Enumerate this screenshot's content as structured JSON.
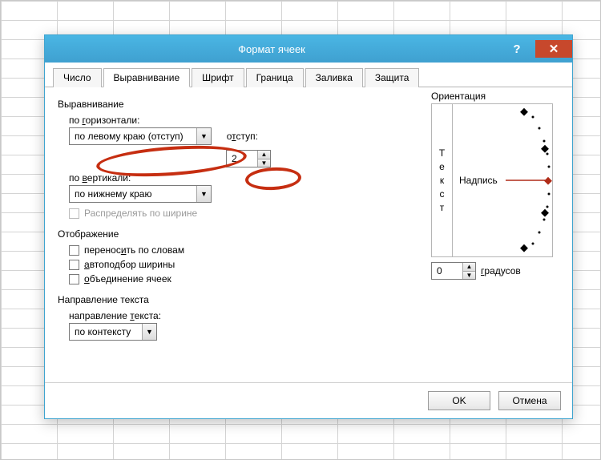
{
  "window": {
    "title": "Формат ячеек"
  },
  "tabs": [
    "Число",
    "Выравнивание",
    "Шрифт",
    "Граница",
    "Заливка",
    "Защита"
  ],
  "active_tab": 1,
  "alignment": {
    "group_title": "Выравнивание",
    "horiz_label": "по горизонтали:",
    "horiz_value": "по левому краю (отступ)",
    "indent_label": "отступ:",
    "indent_value": "2",
    "vert_label": "по вертикали:",
    "vert_value": "по нижнему краю",
    "distribute_label": "Распределять по ширине",
    "distribute_enabled": false
  },
  "display": {
    "group_title": "Отображение",
    "wrap": "переносить по словам",
    "shrink": "автоподбор ширины",
    "merge": "объединение ячеек"
  },
  "direction": {
    "group_title": "Направление текста",
    "label": "направление текста:",
    "value": "по контексту"
  },
  "orientation": {
    "group_title": "Ориентация",
    "vertical_word": "Текст",
    "label": "Надпись",
    "degrees_value": "0",
    "degrees_label": "градусов"
  },
  "buttons": {
    "ok": "OK",
    "cancel": "Отмена"
  }
}
